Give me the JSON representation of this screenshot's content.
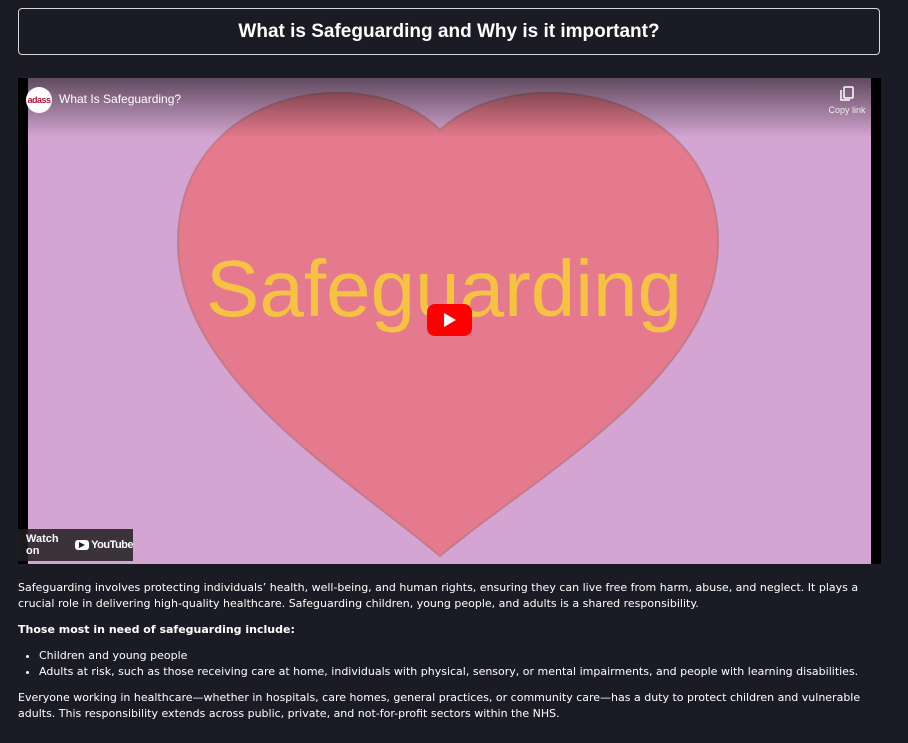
{
  "page": {
    "title": "What is Safeguarding and Why is it important?"
  },
  "video": {
    "title": "What Is Safeguarding?",
    "channel_logo_text": "adass",
    "copy_link_label": "Copy link",
    "thumbnail_text": "Safeguarding",
    "watch_on_label": "Watch on",
    "youtube_label": "YouTube",
    "colors": {
      "background": "#d4a5d2",
      "heart": "#e57a8e",
      "heart_text": "#f5c242",
      "play_button": "#ff0000"
    }
  },
  "content": {
    "intro": "Safeguarding involves protecting individuals’ health, well-being, and human rights, ensuring they can live free from harm, abuse, and neglect. It plays a crucial role in delivering high-quality healthcare. Safeguarding children, young people, and adults is a shared responsibility.",
    "list_heading": "Those most in need of safeguarding include:",
    "list_items": [
      "Children and young people",
      "Adults at risk, such as those receiving care at home, individuals with physical, sensory, or mental impairments, and people with learning disabilities."
    ],
    "closing": "Everyone working in healthcare—whether in hospitals, care homes, general practices, or community care—has a duty to protect children and vulnerable adults. This responsibility extends across public, private, and not-for-profit sectors within the NHS."
  }
}
